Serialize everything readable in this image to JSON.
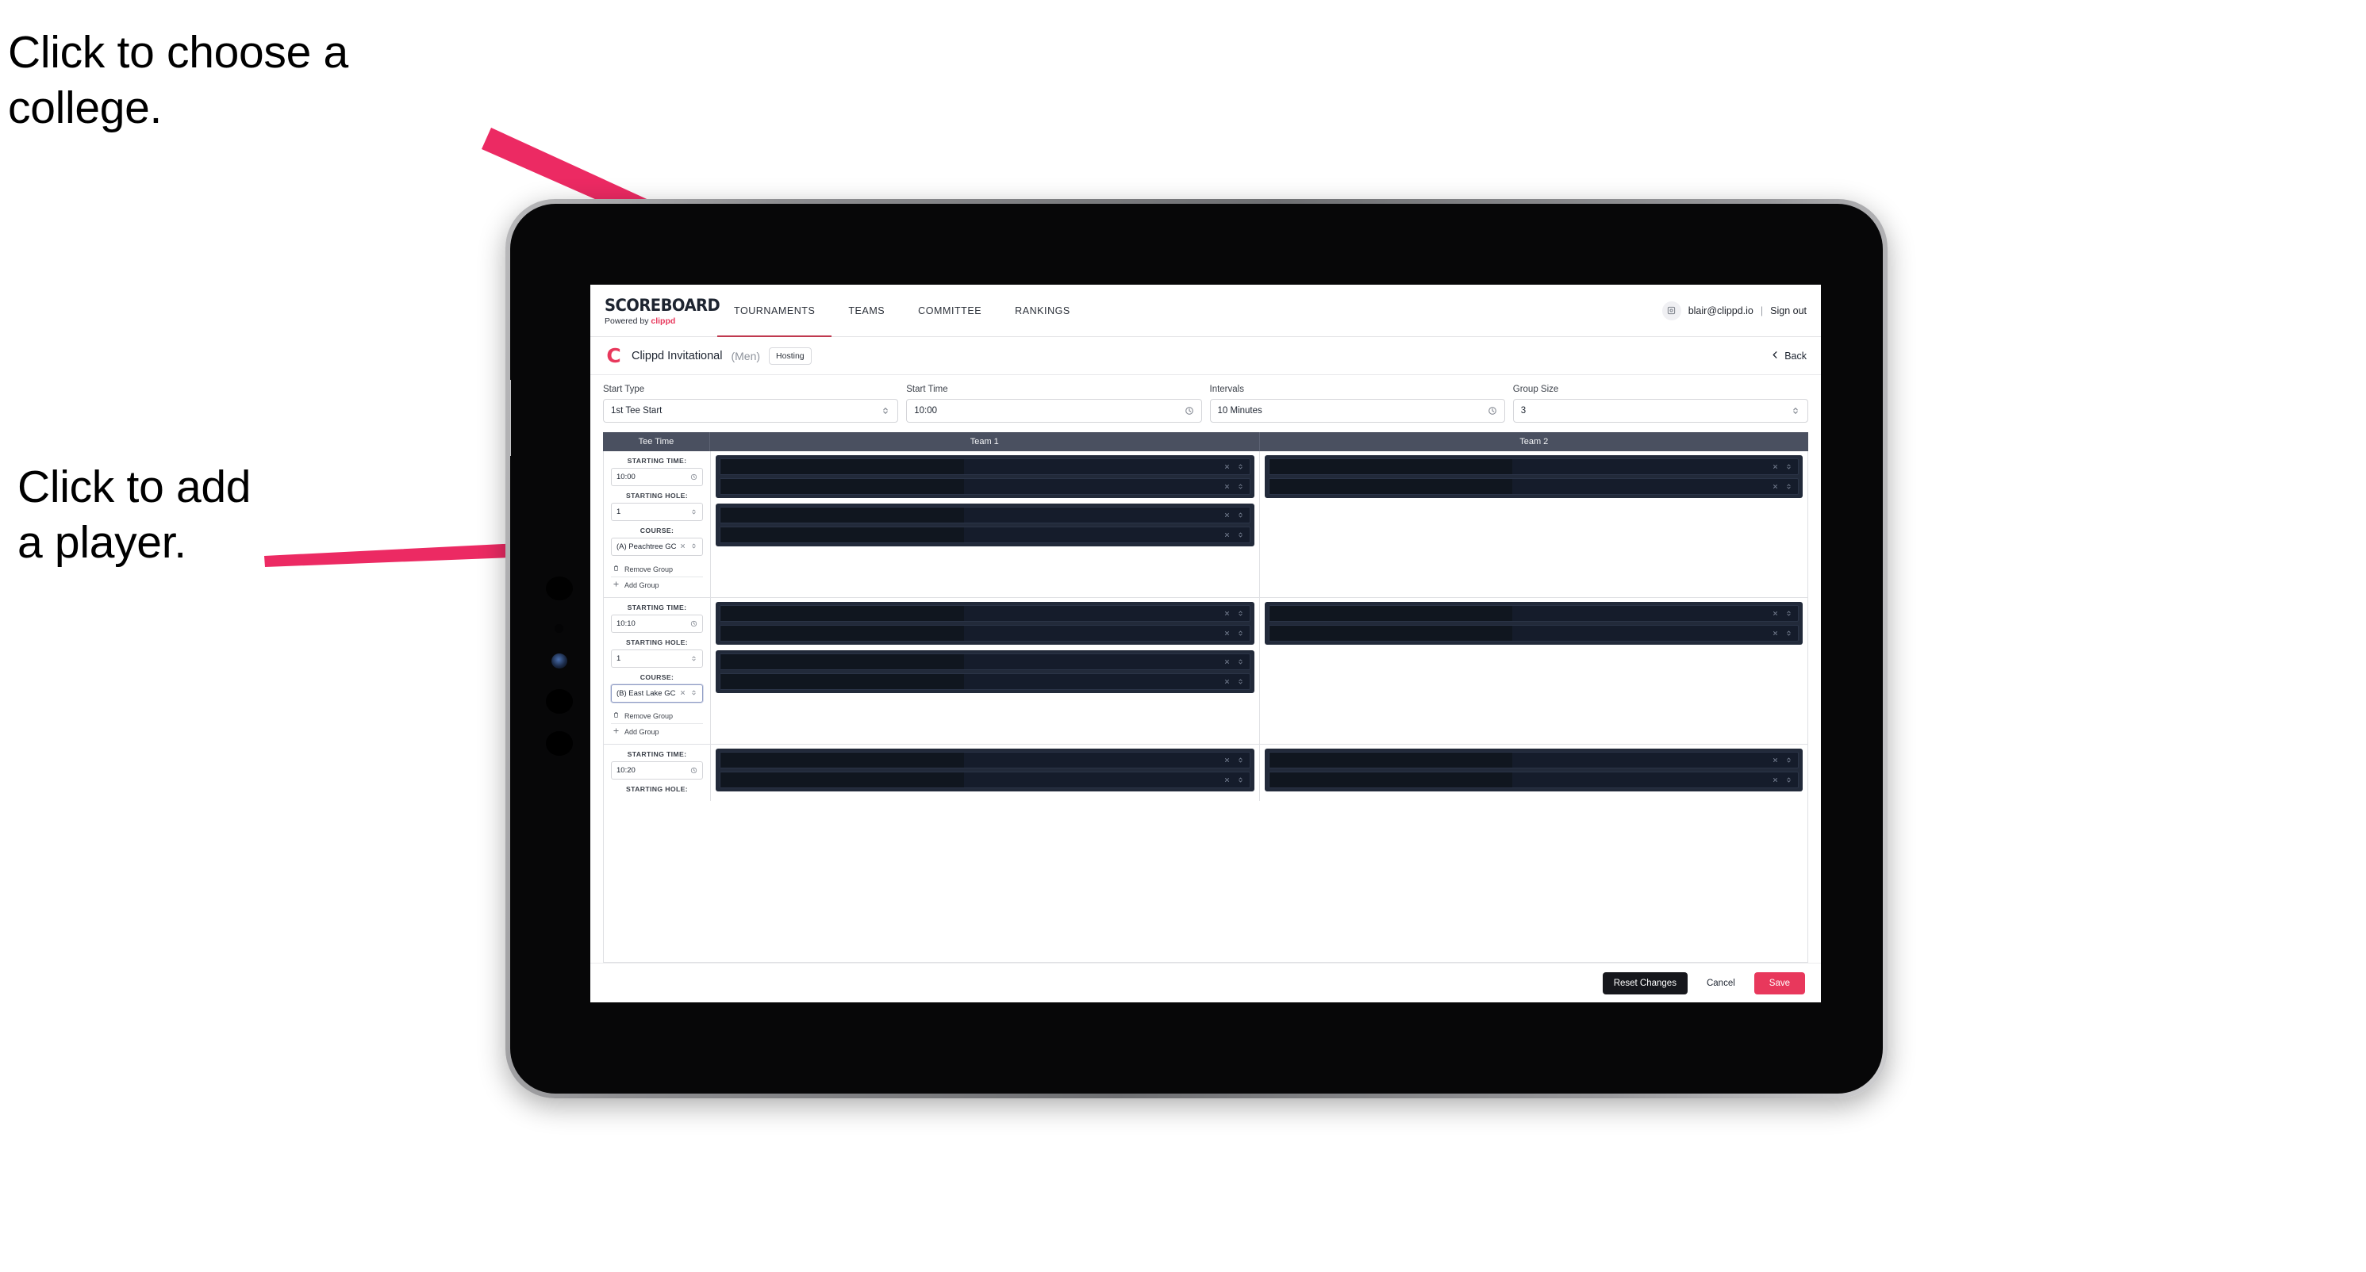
{
  "annotations": {
    "college": "Click to choose a\ncollege.",
    "player": "Click to add\na player."
  },
  "brand": {
    "title": "SCOREBOARD",
    "powered_prefix": "Powered by ",
    "powered_name": "clippd"
  },
  "nav": {
    "tabs": [
      {
        "label": "TOURNAMENTS",
        "active": true
      },
      {
        "label": "TEAMS",
        "active": false
      },
      {
        "label": "COMMITTEE",
        "active": false
      },
      {
        "label": "RANKINGS",
        "active": false
      }
    ],
    "user_email": "blair@clippd.io",
    "separator": "|",
    "sign_out": "Sign out",
    "avatar_icon": "user-icon"
  },
  "tournament_bar": {
    "logo_text": "C",
    "name": "Clippd Invitational",
    "gender": "(Men)",
    "role_badge": "Hosting",
    "back_label": "Back",
    "back_icon": "chevron-left-icon"
  },
  "settings": [
    {
      "label": "Start Type",
      "value": "1st Tee Start",
      "icon": "chevron-updown-icon"
    },
    {
      "label": "Start Time",
      "value": "10:00",
      "icon": "clock-icon"
    },
    {
      "label": "Intervals",
      "value": "10 Minutes",
      "icon": "clock-icon"
    },
    {
      "label": "Group Size",
      "value": "3",
      "icon": "chevron-updown-icon"
    }
  ],
  "table": {
    "headers": [
      "Tee Time",
      "Team 1",
      "Team 2"
    ],
    "field_labels": {
      "starting_time": "STARTING TIME:",
      "starting_hole": "STARTING HOLE:",
      "course": "COURSE:"
    },
    "group_actions": {
      "remove": "Remove Group",
      "add": "Add Group",
      "remove_icon": "trash-icon",
      "add_icon": "plus-icon"
    },
    "player_row_icons": {
      "clear": "close-icon",
      "select": "chevron-updown-icon"
    },
    "groups": [
      {
        "starting_time": "10:00",
        "starting_hole": "1",
        "course": "(A) Peachtree GC",
        "course_focused": false,
        "teams": [
          {
            "players": [
              "",
              ""
            ]
          },
          {
            "players": [
              "",
              ""
            ]
          }
        ]
      },
      {
        "starting_time": "10:10",
        "starting_hole": "1",
        "course": "(B) East Lake GC",
        "course_focused": true,
        "teams": [
          {
            "players": [
              "",
              ""
            ]
          },
          {
            "players": [
              "",
              ""
            ]
          }
        ]
      },
      {
        "starting_time": "10:20",
        "starting_hole": "",
        "course": "",
        "course_focused": false,
        "teams": [
          {
            "players": [
              "",
              ""
            ]
          },
          {
            "players": [
              "",
              ""
            ]
          }
        ]
      }
    ]
  },
  "footer": {
    "reset": "Reset Changes",
    "cancel": "Cancel",
    "save": "Save"
  },
  "colors": {
    "accent_pink": "#e8385c",
    "annotation_arrow": "#ec2a63",
    "table_header": "#4a5060",
    "redaction": "#222a3a"
  }
}
